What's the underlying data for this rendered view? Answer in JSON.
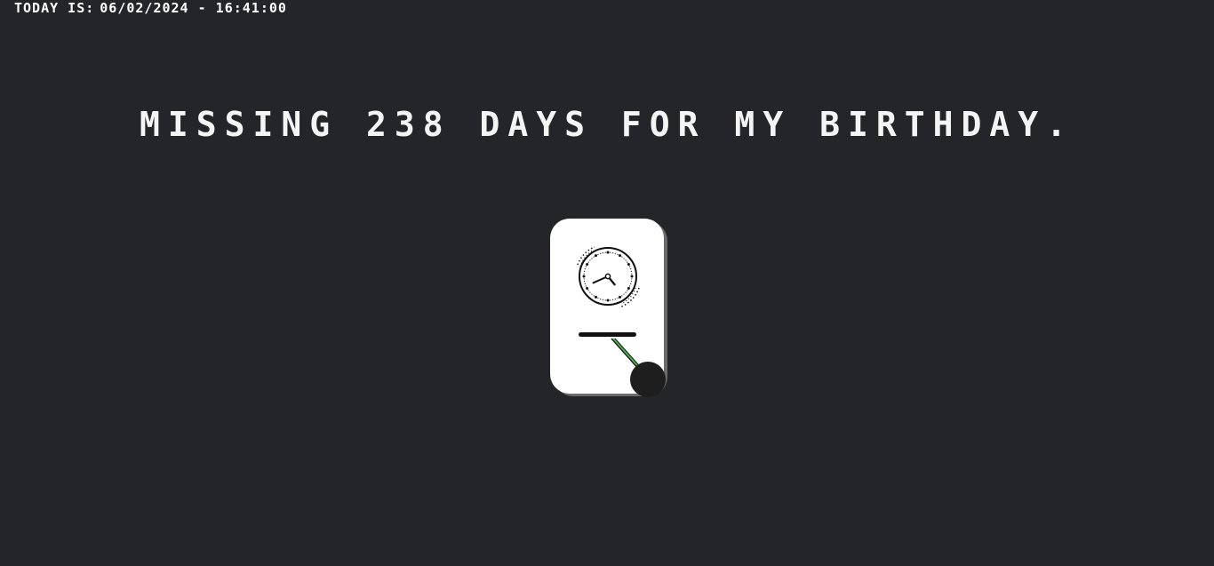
{
  "header": {
    "label": "TODAY IS:",
    "datetime": "06/02/2024 - 16:41:00"
  },
  "headline": "MISSING 238 DAYS FOR MY BIRTHDAY.",
  "clock": {
    "icon": "pendulum-clock-icon",
    "hour": 4,
    "minute": 41,
    "colors": {
      "card": "#ffffff",
      "face_stroke": "#111111",
      "pendulum_rod": "#4caf50",
      "bob": "#1e1e1e",
      "background": "#232529"
    }
  }
}
